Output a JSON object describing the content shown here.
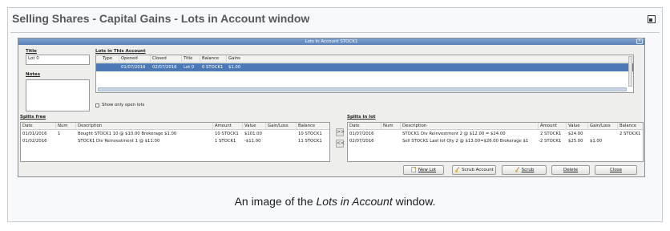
{
  "page": {
    "heading": "Selling Shares - Capital Gains - Lots in Account window",
    "caption_pre": "An image of the ",
    "caption_em": "Lots in Account",
    "caption_post": " window."
  },
  "window": {
    "title": "Lots in Account STOCK1",
    "close_glyph": "×"
  },
  "lot_form": {
    "title_label": "Title",
    "title_value": "Lot 0",
    "notes_label": "Notes",
    "notes_value": ""
  },
  "lots_table": {
    "label": "Lots in This Account",
    "columns": [
      "Type",
      "Opened",
      "Closed",
      "Title",
      "Balance",
      "Gains"
    ],
    "rows": [
      [
        "",
        "01/07/2016",
        "02/07/2016",
        "Lot 0",
        "0 STOCK1",
        "$1.00"
      ]
    ],
    "show_open_label": "Show only open lots"
  },
  "splits_free": {
    "label": "Splits free",
    "columns": [
      "Date",
      "Num",
      "Description",
      "Amount",
      "Value",
      "Gain/Loss",
      "Balance"
    ],
    "rows": [
      [
        "01/01/2016",
        "1",
        "Bought STOCK1 10 @ $10.00 Brokerage $1.00",
        "10 STOCK1",
        "$101.00",
        "",
        "10 STOCK1"
      ],
      [
        "01/02/2016",
        "",
        "STOCK1 Div Reinvestment 1 @ $11.00",
        "1 STOCK1",
        "-$11.00",
        "",
        "11 STOCK1"
      ]
    ]
  },
  "splits_in_lot": {
    "label": "Splits in lot",
    "columns": [
      "Date",
      "Num",
      "Description",
      "Amount",
      "Value",
      "Gain/Loss",
      "Balance"
    ],
    "rows": [
      [
        "01/07/2016",
        "",
        "STOCK1 Div Reinvestment 2 @ $12.00 = $24.00",
        "2 STOCK1",
        "$24.00",
        "",
        "2 STOCK1"
      ],
      [
        "02/07/2016",
        "",
        "Sell STOCK1 Last lot Qty 2 @ $13.00=$26.00 Brokerage $1",
        "-2 STOCK1",
        "$25.00",
        "$1.00",
        ""
      ]
    ]
  },
  "move_buttons": {
    "add": ">>",
    "remove": "<<"
  },
  "buttons": {
    "new_lot": "New Lot",
    "scrub_account": "Scrub Account",
    "scrub": "Scrub",
    "delete": "Delete",
    "close": "Close"
  },
  "icons": {
    "new_lot": "document-new-icon",
    "scrub_account": "broom-icon",
    "scrub": "broom-icon"
  },
  "colors": {
    "selection": "#4a79b5",
    "titlebar": "#5b82b8"
  }
}
